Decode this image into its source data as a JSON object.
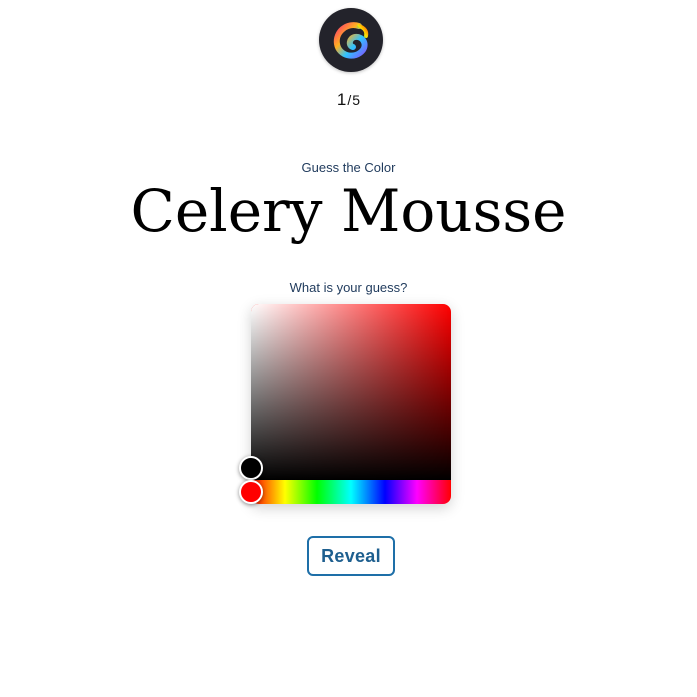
{
  "app": {
    "logo_icon": "swirl-logo-icon"
  },
  "progress": {
    "current": "1",
    "separator": "/",
    "total": "5"
  },
  "prompt": {
    "label": "Guess the Color",
    "color_name": "Celery Mousse"
  },
  "guess": {
    "label": "What is your guess?",
    "hue_color": "#ff0000",
    "selected_color": "#000000"
  },
  "actions": {
    "reveal_label": "Reveal",
    "accent": "#1e6fa8"
  }
}
